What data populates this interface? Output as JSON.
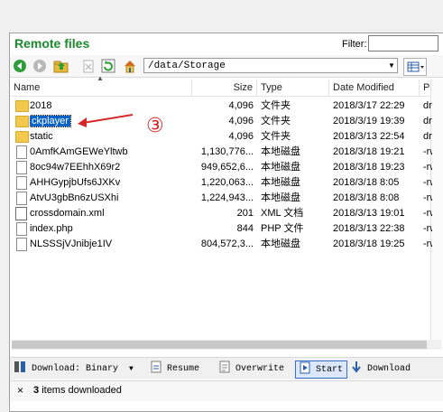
{
  "panel": {
    "title": "Remote files",
    "filter_label": "Filter:",
    "filter_value": ""
  },
  "toolbar": {
    "path": "/data/Storage",
    "icons": [
      "back-icon",
      "forward-icon",
      "up-folder-icon",
      "delete-icon",
      "refresh-icon",
      "home-icon",
      "view-mode-icon"
    ]
  },
  "columns": {
    "name": "Name",
    "size": "Size",
    "type": "Type",
    "modified": "Date Modified",
    "perm": "Per"
  },
  "files": [
    {
      "name": "2018",
      "size": "4,096",
      "type": "文件夹",
      "modified": "2018/3/17 22:29",
      "perm": "drw",
      "kind": "folder"
    },
    {
      "name": "ckplayer",
      "size": "4,096",
      "type": "文件夹",
      "modified": "2018/3/19 19:39",
      "perm": "drw",
      "kind": "folder"
    },
    {
      "name": "static",
      "size": "4,096",
      "type": "文件夹",
      "modified": "2018/3/13 22:54",
      "perm": "drw",
      "kind": "folder"
    },
    {
      "name": "0AmfKAmGEWeYltwb",
      "size": "1,130,776...",
      "type": "本地磁盘",
      "modified": "2018/3/18 19:21",
      "perm": "-rw-",
      "kind": "file"
    },
    {
      "name": "8oc94w7EEhhX69r2",
      "size": "949,652,6...",
      "type": "本地磁盘",
      "modified": "2018/3/18 19:23",
      "perm": "-rw-",
      "kind": "file"
    },
    {
      "name": "AHHGypjbUfs6JXKv",
      "size": "1,220,063...",
      "type": "本地磁盘",
      "modified": "2018/3/18 8:05",
      "perm": "-rw-",
      "kind": "file"
    },
    {
      "name": "AtvU3gbBn6zUSXhi",
      "size": "1,224,943...",
      "type": "本地磁盘",
      "modified": "2018/3/18 8:08",
      "perm": "-rw-",
      "kind": "file"
    },
    {
      "name": "crossdomain.xml",
      "size": "201",
      "type": "XML 文档",
      "modified": "2018/3/13 19:01",
      "perm": "-rw-",
      "kind": "xml"
    },
    {
      "name": "index.php",
      "size": "844",
      "type": "PHP 文件",
      "modified": "2018/3/13 22:38",
      "perm": "-rw-",
      "kind": "file"
    },
    {
      "name": "NLSSSjVJnibje1IV",
      "size": "804,572,3...",
      "type": "本地磁盘",
      "modified": "2018/3/18 19:25",
      "perm": "-rw-",
      "kind": "file"
    }
  ],
  "selected_index": 1,
  "annotation": {
    "marker": "③",
    "color": "#d62828"
  },
  "bottom": {
    "download_mode": "Download: Binary",
    "resume": "Resume",
    "overwrite": "Overwrite",
    "start": "Start",
    "download": "Download"
  },
  "status": {
    "count": "3",
    "text": "items downloaded"
  },
  "colors": {
    "title": "#1a8a2a",
    "selection": "#0a64c8",
    "folder": "#f2c94c"
  }
}
